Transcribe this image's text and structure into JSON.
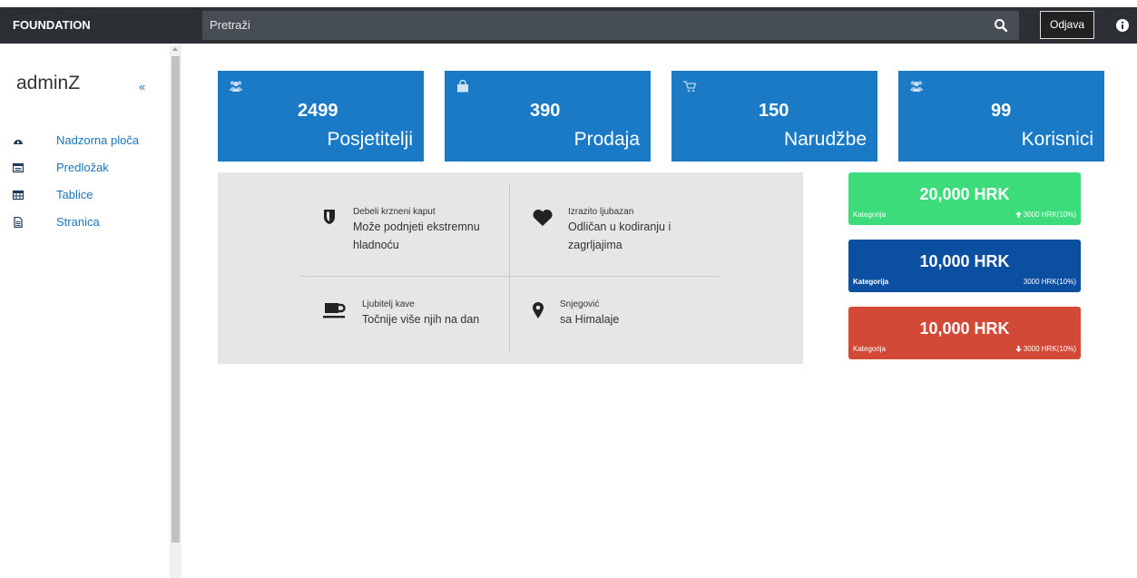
{
  "topbar": {
    "brand": "FOUNDATION",
    "search_placeholder": "Pretraži",
    "logout_label": "Odjava"
  },
  "sidebar": {
    "username": "adminZ",
    "collapse_symbol": "«",
    "items": [
      {
        "label": "Nadzorna ploča",
        "icon": "dashboard-icon"
      },
      {
        "label": "Predložak",
        "icon": "template-icon"
      },
      {
        "label": "Tablice",
        "icon": "table-icon"
      },
      {
        "label": "Stranica",
        "icon": "page-icon"
      }
    ]
  },
  "stats": [
    {
      "value": "2499",
      "label": "Posjetitelji",
      "icon": "users-icon"
    },
    {
      "value": "390",
      "label": "Prodaja",
      "icon": "shopping-bag-icon"
    },
    {
      "value": "150",
      "label": "Narudžbe",
      "icon": "cart-icon"
    },
    {
      "value": "99",
      "label": "Korisnici",
      "icon": "users-icon"
    }
  ],
  "features": [
    {
      "title": "Debeli krzneni kaput",
      "text": "Može podnjeti ekstremnu hladnoću",
      "icon": "shield-icon"
    },
    {
      "title": "Izrazito ljubazan",
      "text": "Odličan u kodiranju i zagrljajima",
      "icon": "heart-icon"
    },
    {
      "title": "Ljubitelj kave",
      "text": "Točnije više njih na dan",
      "icon": "coffee-icon"
    },
    {
      "title": "Snjegović",
      "text": "sa Himalaje",
      "icon": "map-marker-icon"
    }
  ],
  "cards": [
    {
      "amount": "20,000 HRK",
      "category": "Kategorija",
      "change": "3000 HRK(10%)",
      "trend": "up",
      "color": "#3ddc7a"
    },
    {
      "amount": "10,000 HRK",
      "category": "Kategorija",
      "change": "3000 HRK(10%)",
      "trend": "none",
      "color": "#0b4fa0"
    },
    {
      "amount": "10,000 HRK",
      "category": "Kategorija",
      "change": "3000 HRK(10%)",
      "trend": "down",
      "color": "#d24a37"
    }
  ],
  "colors": {
    "topbar": "#2c3034",
    "stat_tile": "#1a7ac5",
    "link": "#1a75bb"
  }
}
